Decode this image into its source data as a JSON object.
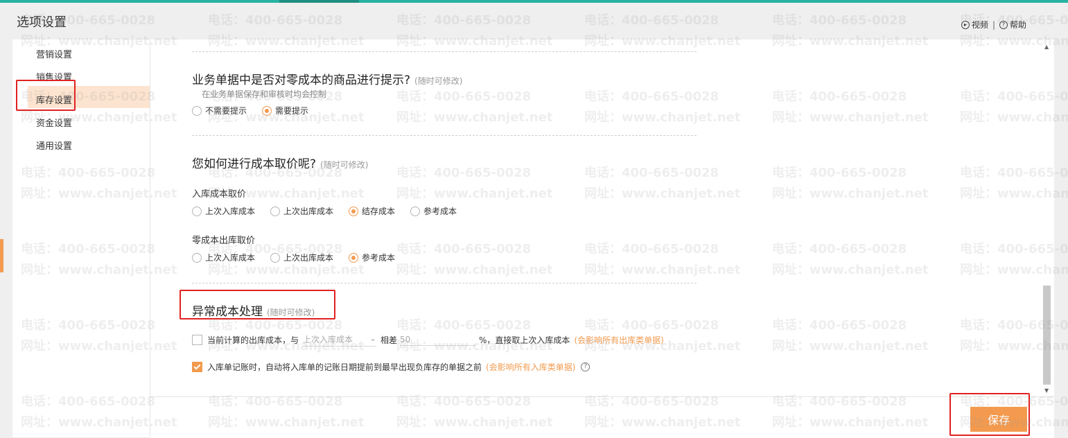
{
  "window": {
    "title": "选项设置"
  },
  "toplinks": {
    "video": "视频",
    "help": "帮助"
  },
  "sidebar": {
    "items": [
      {
        "label": "营销设置"
      },
      {
        "label": "销售设置"
      },
      {
        "label": "库存设置",
        "active": true
      },
      {
        "label": "资金设置"
      },
      {
        "label": "通用设置"
      }
    ]
  },
  "section_zero_cost": {
    "question": "业务单据中是否对零成本的商品进行提示?",
    "note": "(随时可修改)",
    "sub": "在业务单据保存和审核时均会控制",
    "options": [
      {
        "label": "不需要提示",
        "selected": false
      },
      {
        "label": "需要提示",
        "selected": true
      }
    ]
  },
  "section_cost_price": {
    "question": "您如何进行成本取价呢?",
    "note": "(随时可修改)",
    "inbound": {
      "label": "入库成本取价",
      "options": [
        {
          "label": "上次入库成本",
          "selected": false
        },
        {
          "label": "上次出库成本",
          "selected": false
        },
        {
          "label": "结存成本",
          "selected": true
        },
        {
          "label": "参考成本",
          "selected": false
        }
      ]
    },
    "zero_outbound": {
      "label": "零成本出库取价",
      "options": [
        {
          "label": "上次入库成本",
          "selected": false
        },
        {
          "label": "上次出库成本",
          "selected": false
        },
        {
          "label": "参考成本",
          "selected": true
        }
      ]
    }
  },
  "section_abnormal": {
    "title": "异常成本处理",
    "note": "(随时可修改)",
    "option1": {
      "checked": false,
      "prefix": "当前计算的出库成本，与",
      "select_value": "上次入库成本",
      "diff_label": "相差",
      "input_value": "50",
      "suffix": "%，直接取上次入库成本",
      "warning": "(会影响所有出库类单据)"
    },
    "option2": {
      "checked": true,
      "text": "入库单记账时，自动将入库单的记账日期提前到最早出现负库存的单据之前",
      "warning": "(会影响所有入库类单据)"
    }
  },
  "footer": {
    "save_label": "保存"
  },
  "watermark": {
    "line1": "电话：400-665-0028",
    "line2": "网址：www.chanjet.net"
  },
  "colors": {
    "accent": "#f39a4f",
    "topbar": "#27b3a0",
    "annotation": "#e02020"
  }
}
